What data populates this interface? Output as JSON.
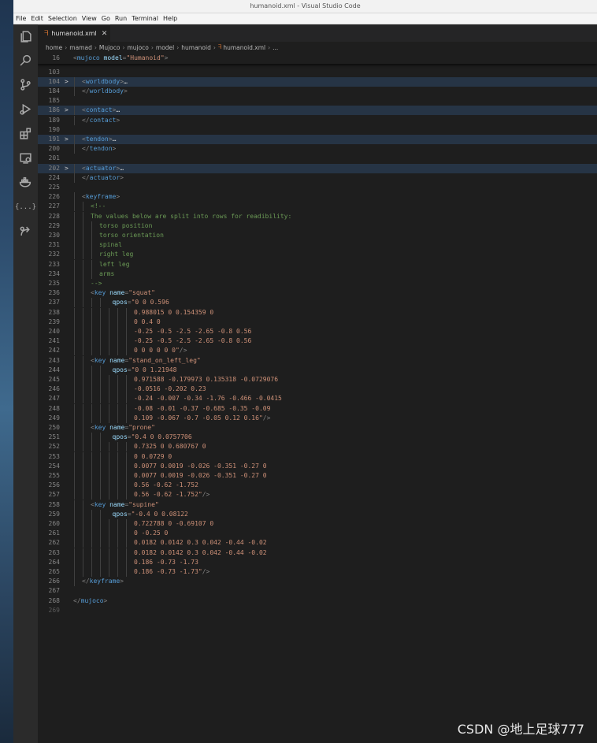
{
  "window": {
    "title": "humanoid.xml - Visual Studio Code"
  },
  "menu": [
    "File",
    "Edit",
    "Selection",
    "View",
    "Go",
    "Run",
    "Terminal",
    "Help"
  ],
  "activity_icons": [
    "explorer-icon",
    "search-icon",
    "source-control-icon",
    "run-debug-icon",
    "extensions-icon",
    "remote-explorer-icon",
    "docker-icon",
    "json-icon",
    "live-share-icon"
  ],
  "activity_json_glyph": "{...}",
  "tab": {
    "icon": "rss-icon",
    "label": "humanoid.xml",
    "close": "✕"
  },
  "breadcrumb": [
    "home",
    "mamad",
    "Mujoco",
    "mujoco",
    "model",
    "humanoid",
    "humanoid.xml",
    "..."
  ],
  "sticky": {
    "num": "16",
    "parts": [
      [
        "punc",
        "<"
      ],
      [
        "tag",
        "mujoco"
      ],
      [
        "attr",
        " model"
      ],
      [
        "punc",
        "="
      ],
      [
        "str",
        "\"Humanoid\""
      ],
      [
        "punc",
        ">"
      ]
    ]
  },
  "lines": [
    {
      "num": "103",
      "indent": 0,
      "parts": []
    },
    {
      "num": "104",
      "indent": 1,
      "fold": ">",
      "hl": true,
      "parts": [
        [
          "punc",
          "<"
        ],
        [
          "tag",
          "worldbody"
        ],
        [
          "punc",
          ">"
        ],
        [
          "txt",
          "…"
        ]
      ]
    },
    {
      "num": "184",
      "indent": 1,
      "parts": [
        [
          "punc",
          "</"
        ],
        [
          "tag",
          "worldbody"
        ],
        [
          "punc",
          ">"
        ]
      ]
    },
    {
      "num": "185",
      "indent": 0,
      "parts": []
    },
    {
      "num": "186",
      "indent": 1,
      "fold": ">",
      "hl": true,
      "parts": [
        [
          "punc",
          "<"
        ],
        [
          "tag",
          "contact"
        ],
        [
          "punc",
          ">"
        ],
        [
          "txt",
          "…"
        ]
      ]
    },
    {
      "num": "189",
      "indent": 1,
      "parts": [
        [
          "punc",
          "</"
        ],
        [
          "tag",
          "contact"
        ],
        [
          "punc",
          ">"
        ]
      ]
    },
    {
      "num": "190",
      "indent": 0,
      "parts": []
    },
    {
      "num": "191",
      "indent": 1,
      "fold": ">",
      "hl": true,
      "parts": [
        [
          "punc",
          "<"
        ],
        [
          "tag",
          "tendon"
        ],
        [
          "punc",
          ">"
        ],
        [
          "txt",
          "…"
        ]
      ]
    },
    {
      "num": "200",
      "indent": 1,
      "parts": [
        [
          "punc",
          "</"
        ],
        [
          "tag",
          "tendon"
        ],
        [
          "punc",
          ">"
        ]
      ]
    },
    {
      "num": "201",
      "indent": 0,
      "parts": []
    },
    {
      "num": "202",
      "indent": 1,
      "fold": ">",
      "hl": true,
      "parts": [
        [
          "punc",
          "<"
        ],
        [
          "tag",
          "actuator"
        ],
        [
          "punc",
          ">"
        ],
        [
          "txt",
          "…"
        ]
      ]
    },
    {
      "num": "224",
      "indent": 1,
      "parts": [
        [
          "punc",
          "</"
        ],
        [
          "tag",
          "actuator"
        ],
        [
          "punc",
          ">"
        ]
      ]
    },
    {
      "num": "225",
      "indent": 0,
      "parts": []
    },
    {
      "num": "226",
      "indent": 1,
      "parts": [
        [
          "punc",
          "<"
        ],
        [
          "tag",
          "keyframe"
        ],
        [
          "punc",
          ">"
        ]
      ]
    },
    {
      "num": "227",
      "indent": 2,
      "parts": [
        [
          "cmt",
          "<!--"
        ]
      ]
    },
    {
      "num": "228",
      "indent": 2,
      "parts": [
        [
          "cmt",
          "The values below are split into rows for readibility:"
        ]
      ]
    },
    {
      "num": "229",
      "indent": 3,
      "parts": [
        [
          "cmt",
          "torso position"
        ]
      ]
    },
    {
      "num": "230",
      "indent": 3,
      "parts": [
        [
          "cmt",
          "torso orientation"
        ]
      ]
    },
    {
      "num": "231",
      "indent": 3,
      "parts": [
        [
          "cmt",
          "spinal"
        ]
      ]
    },
    {
      "num": "232",
      "indent": 3,
      "parts": [
        [
          "cmt",
          "right leg"
        ]
      ]
    },
    {
      "num": "233",
      "indent": 3,
      "parts": [
        [
          "cmt",
          "left leg"
        ]
      ]
    },
    {
      "num": "234",
      "indent": 3,
      "parts": [
        [
          "cmt",
          "arms"
        ]
      ]
    },
    {
      "num": "235",
      "indent": 2,
      "parts": [
        [
          "cmt",
          "-->"
        ]
      ]
    },
    {
      "num": "236",
      "indent": 2,
      "parts": [
        [
          "punc",
          "<"
        ],
        [
          "tag",
          "key"
        ],
        [
          "attr",
          " name"
        ],
        [
          "punc",
          "="
        ],
        [
          "str",
          "\"squat\""
        ]
      ]
    },
    {
      "num": "237",
      "indent": 4.5,
      "parts": [
        [
          "attr",
          "qpos"
        ],
        [
          "punc",
          "="
        ],
        [
          "str",
          "\"0 0 0.596"
        ]
      ]
    },
    {
      "num": "238",
      "indent": 7,
      "parts": [
        [
          "str",
          "0.988015 0 0.154359 0"
        ]
      ]
    },
    {
      "num": "239",
      "indent": 7,
      "parts": [
        [
          "str",
          "0 0.4 0"
        ]
      ]
    },
    {
      "num": "240",
      "indent": 7,
      "parts": [
        [
          "str",
          "-0.25 -0.5 -2.5 -2.65 -0.8 0.56"
        ]
      ]
    },
    {
      "num": "241",
      "indent": 7,
      "parts": [
        [
          "str",
          "-0.25 -0.5 -2.5 -2.65 -0.8 0.56"
        ]
      ]
    },
    {
      "num": "242",
      "indent": 7,
      "parts": [
        [
          "str",
          "0 0 0 0 0 0\""
        ],
        [
          "punc",
          "/>"
        ]
      ]
    },
    {
      "num": "243",
      "indent": 2,
      "parts": [
        [
          "punc",
          "<"
        ],
        [
          "tag",
          "key"
        ],
        [
          "attr",
          " name"
        ],
        [
          "punc",
          "="
        ],
        [
          "str",
          "\"stand_on_left_leg\""
        ]
      ]
    },
    {
      "num": "244",
      "indent": 4.5,
      "parts": [
        [
          "attr",
          "qpos"
        ],
        [
          "punc",
          "="
        ],
        [
          "str",
          "\"0 0 1.21948"
        ]
      ]
    },
    {
      "num": "245",
      "indent": 7,
      "parts": [
        [
          "str",
          "0.971588 -0.179973 0.135318 -0.0729076"
        ]
      ]
    },
    {
      "num": "246",
      "indent": 7,
      "parts": [
        [
          "str",
          "-0.0516 -0.202 0.23"
        ]
      ]
    },
    {
      "num": "247",
      "indent": 7,
      "parts": [
        [
          "str",
          "-0.24 -0.007 -0.34 -1.76 -0.466 -0.0415"
        ]
      ]
    },
    {
      "num": "248",
      "indent": 7,
      "parts": [
        [
          "str",
          "-0.08 -0.01 -0.37 -0.685 -0.35 -0.09"
        ]
      ]
    },
    {
      "num": "249",
      "indent": 7,
      "parts": [
        [
          "str",
          "0.109 -0.067 -0.7 -0.05 0.12 0.16\""
        ],
        [
          "punc",
          "/>"
        ]
      ]
    },
    {
      "num": "250",
      "indent": 2,
      "parts": [
        [
          "punc",
          "<"
        ],
        [
          "tag",
          "key"
        ],
        [
          "attr",
          " name"
        ],
        [
          "punc",
          "="
        ],
        [
          "str",
          "\"prone\""
        ]
      ]
    },
    {
      "num": "251",
      "indent": 4.5,
      "parts": [
        [
          "attr",
          "qpos"
        ],
        [
          "punc",
          "="
        ],
        [
          "str",
          "\"0.4 0 0.0757706"
        ]
      ]
    },
    {
      "num": "252",
      "indent": 7,
      "parts": [
        [
          "str",
          "0.7325 0 0.680767 0"
        ]
      ]
    },
    {
      "num": "253",
      "indent": 7,
      "parts": [
        [
          "str",
          "0 0.0729 0"
        ]
      ]
    },
    {
      "num": "254",
      "indent": 7,
      "parts": [
        [
          "str",
          "0.0077 0.0019 -0.026 -0.351 -0.27 0"
        ]
      ]
    },
    {
      "num": "255",
      "indent": 7,
      "parts": [
        [
          "str",
          "0.0077 0.0019 -0.026 -0.351 -0.27 0"
        ]
      ]
    },
    {
      "num": "256",
      "indent": 7,
      "parts": [
        [
          "str",
          "0.56 -0.62 -1.752"
        ]
      ]
    },
    {
      "num": "257",
      "indent": 7,
      "parts": [
        [
          "str",
          "0.56 -0.62 -1.752\""
        ],
        [
          "punc",
          "/>"
        ]
      ]
    },
    {
      "num": "258",
      "indent": 2,
      "parts": [
        [
          "punc",
          "<"
        ],
        [
          "tag",
          "key"
        ],
        [
          "attr",
          " name"
        ],
        [
          "punc",
          "="
        ],
        [
          "str",
          "\"supine\""
        ]
      ]
    },
    {
      "num": "259",
      "indent": 4.5,
      "parts": [
        [
          "attr",
          "qpos"
        ],
        [
          "punc",
          "="
        ],
        [
          "str",
          "\"-0.4 0 0.08122"
        ]
      ]
    },
    {
      "num": "260",
      "indent": 7,
      "parts": [
        [
          "str",
          "0.722788 0 -0.69107 0"
        ]
      ]
    },
    {
      "num": "261",
      "indent": 7,
      "parts": [
        [
          "str",
          "0 -0.25 0"
        ]
      ]
    },
    {
      "num": "262",
      "indent": 7,
      "parts": [
        [
          "str",
          "0.0182 0.0142 0.3 0.042 -0.44 -0.02"
        ]
      ]
    },
    {
      "num": "263",
      "indent": 7,
      "parts": [
        [
          "str",
          "0.0182 0.0142 0.3 0.042 -0.44 -0.02"
        ]
      ]
    },
    {
      "num": "264",
      "indent": 7,
      "parts": [
        [
          "str",
          "0.186 -0.73 -1.73"
        ]
      ]
    },
    {
      "num": "265",
      "indent": 7,
      "parts": [
        [
          "str",
          "0.186 -0.73 -1.73\""
        ],
        [
          "punc",
          "/>"
        ]
      ]
    },
    {
      "num": "266",
      "indent": 1,
      "parts": [
        [
          "punc",
          "</"
        ],
        [
          "tag",
          "keyframe"
        ],
        [
          "punc",
          ">"
        ]
      ]
    },
    {
      "num": "267",
      "indent": 0,
      "parts": []
    },
    {
      "num": "268",
      "indent": 0,
      "parts": [
        [
          "punc",
          "</"
        ],
        [
          "tag",
          "mujoco"
        ],
        [
          "punc",
          ">"
        ]
      ]
    },
    {
      "num": "269",
      "indent": 0,
      "dim": true,
      "parts": []
    }
  ],
  "watermark": "CSDN @地上足球777"
}
